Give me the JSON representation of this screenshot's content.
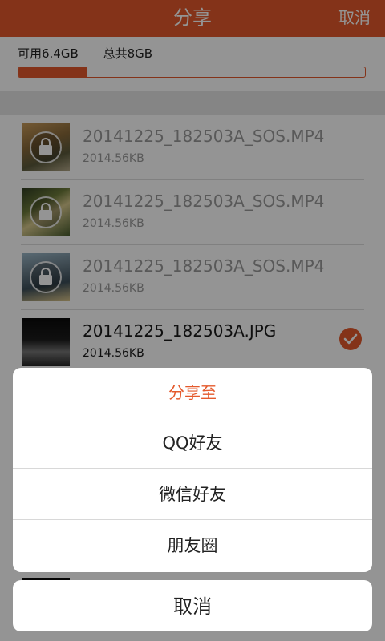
{
  "header": {
    "title": "分享",
    "cancel_label": "取消"
  },
  "storage": {
    "available_label": "可用6.4GB",
    "total_label": "总共8GB",
    "used_fraction": 0.2
  },
  "files": [
    {
      "name": "20141225_182503A_SOS.MP4",
      "size": "2014.56KB",
      "locked": true,
      "selected": false
    },
    {
      "name": "20141225_182503A_SOS.MP4",
      "size": "2014.56KB",
      "locked": true,
      "selected": false
    },
    {
      "name": "20141225_182503A_SOS.MP4",
      "size": "2014.56KB",
      "locked": true,
      "selected": false
    },
    {
      "name": "20141225_182503A.JPG",
      "size": "2014.56KB",
      "locked": false,
      "selected": true
    }
  ],
  "share_sheet": {
    "header": "分享至",
    "options": [
      "QQ好友",
      "微信好友",
      "朋友圈"
    ],
    "cancel_label": "取消"
  },
  "colors": {
    "accent": "#e4592b"
  }
}
